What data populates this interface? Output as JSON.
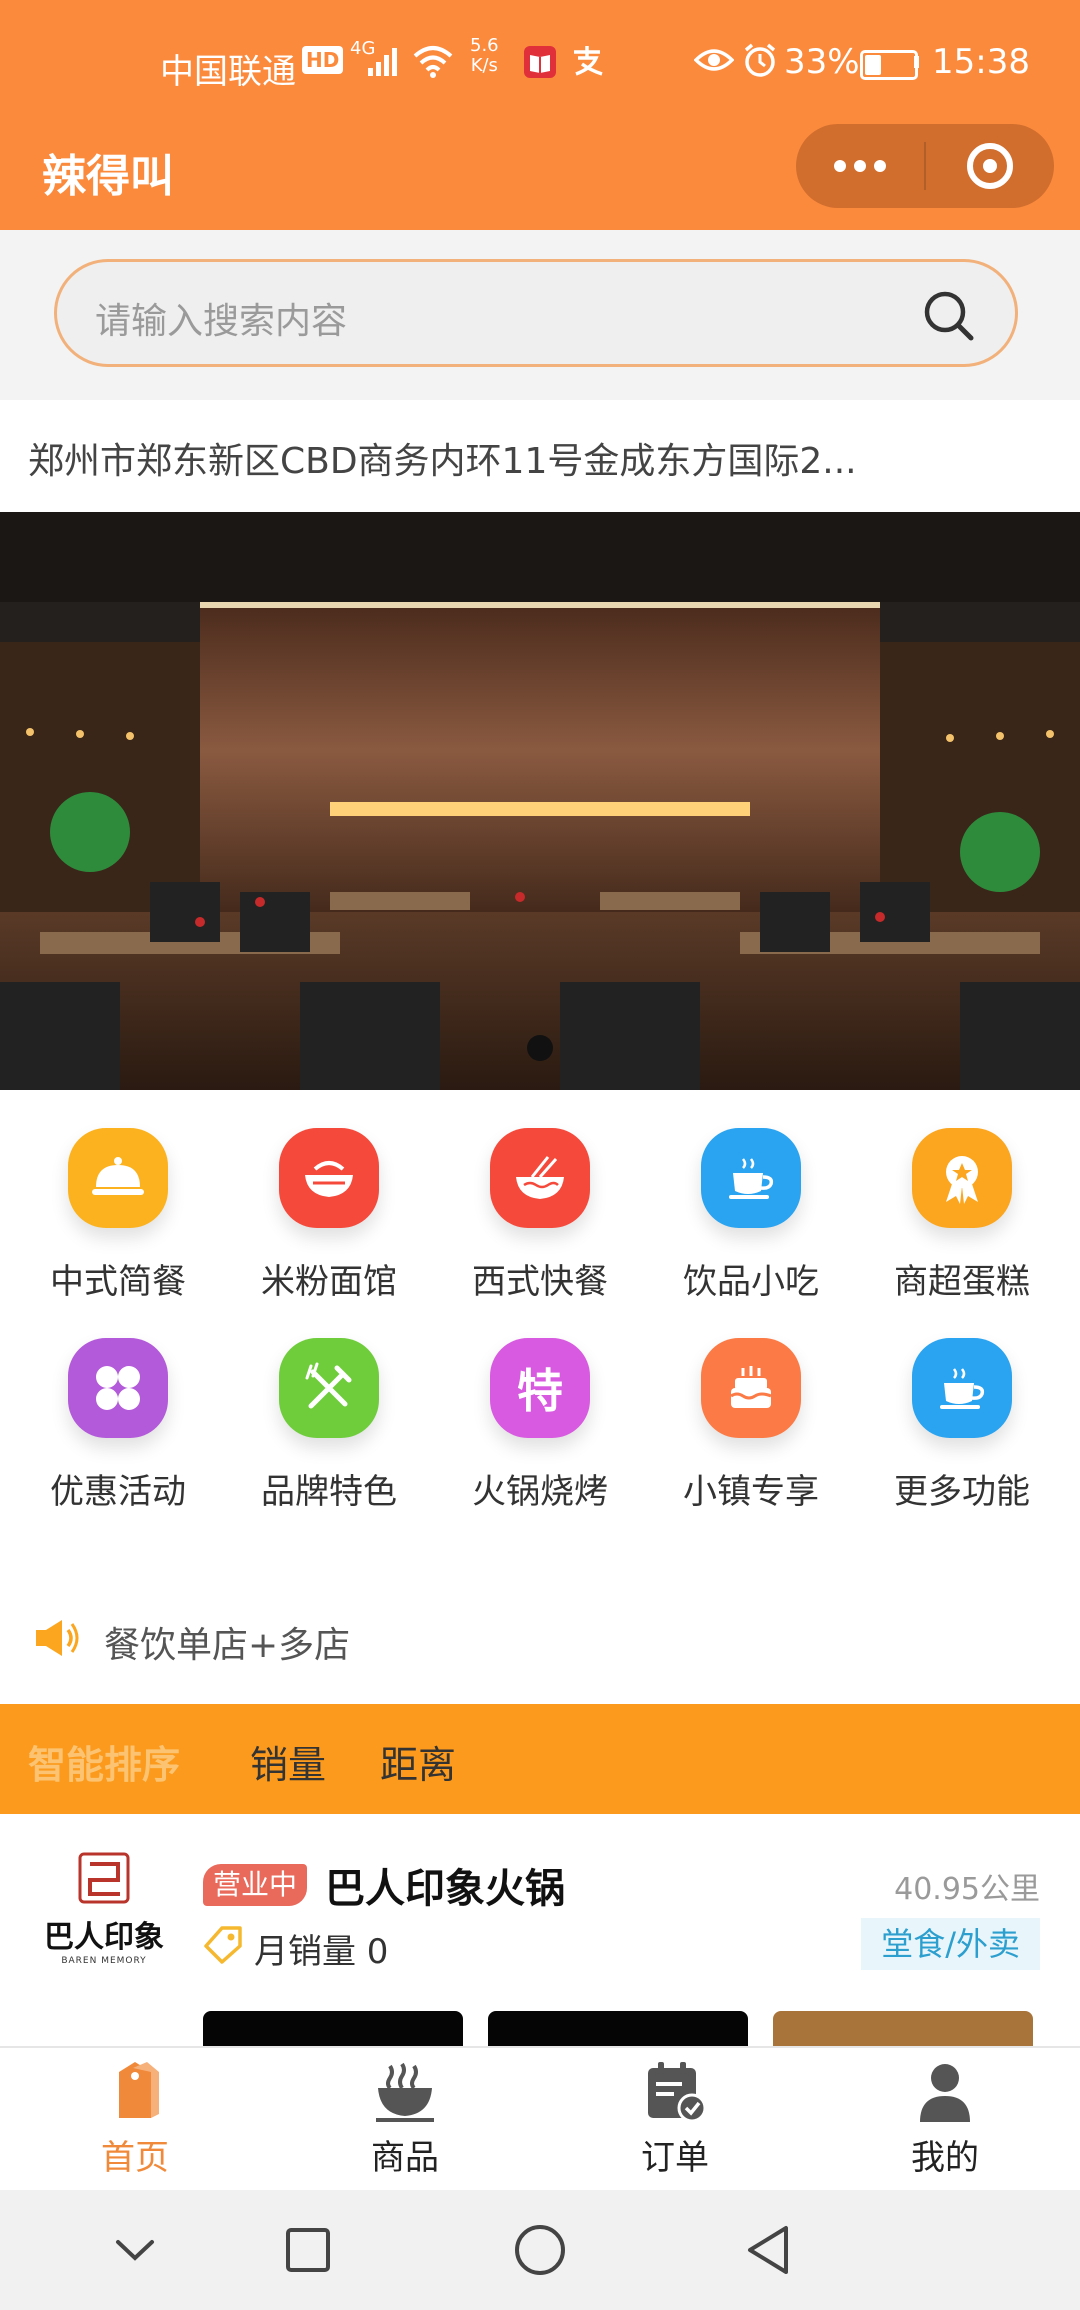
{
  "status_bar": {
    "carrier": "中国联通",
    "hd": "HD",
    "network": "4G",
    "net_speed_value": "5.6",
    "net_speed_unit": "K/s",
    "battery": "33%",
    "time": "15:38"
  },
  "app": {
    "title": "辣得叫"
  },
  "search": {
    "placeholder": "请输入搜索内容"
  },
  "address": "郑州市郑东新区CBD商务内环11号金成东方国际2...",
  "banner": {
    "slide_count": 1,
    "active_slide": 1
  },
  "categories": [
    {
      "label": "中式简餐",
      "icon": "cloche-icon",
      "color": "#fbb21e"
    },
    {
      "label": "米粉面馆",
      "icon": "bowl-icon",
      "color": "#f5493b"
    },
    {
      "label": "西式快餐",
      "icon": "noodle-bowl-icon",
      "color": "#f5493b"
    },
    {
      "label": "饮品小吃",
      "icon": "coffee-cup-icon",
      "color": "#2aa3f0"
    },
    {
      "label": "商超蛋糕",
      "icon": "award-icon",
      "color": "#fba61e"
    },
    {
      "label": "优惠活动",
      "icon": "clover-icon",
      "color": "#b25ad9"
    },
    {
      "label": "品牌特色",
      "icon": "utensils-icon",
      "color": "#6fcd3c"
    },
    {
      "label": "火锅烧烤",
      "icon": "te-character-icon",
      "color": "#d85ae0",
      "glyph": "特"
    },
    {
      "label": "小镇专享",
      "icon": "cake-icon",
      "color": "#fb7a45"
    },
    {
      "label": "更多功能",
      "icon": "coffee-cup-icon",
      "color": "#2aa3f0"
    }
  ],
  "notice": {
    "text": "餐饮单店+多店"
  },
  "sort": {
    "items": [
      "智能排序",
      "销量",
      "距离"
    ],
    "active": "智能排序"
  },
  "store": {
    "status": "营业中",
    "name": "巴人印象火锅",
    "monthly_sales": "月销量 0",
    "distance": "40.95公里",
    "service_mode": "堂食/外卖",
    "logo_text": "巴人印象",
    "logo_subtext": "BAREN MEMORY"
  },
  "tabbar": {
    "items": [
      "首页",
      "商品",
      "订单",
      "我的"
    ],
    "active": "首页"
  },
  "colors": {
    "primary": "#fb8a3d",
    "sort_bar": "#fb9a1c",
    "tab_active": "#f08a3a"
  }
}
